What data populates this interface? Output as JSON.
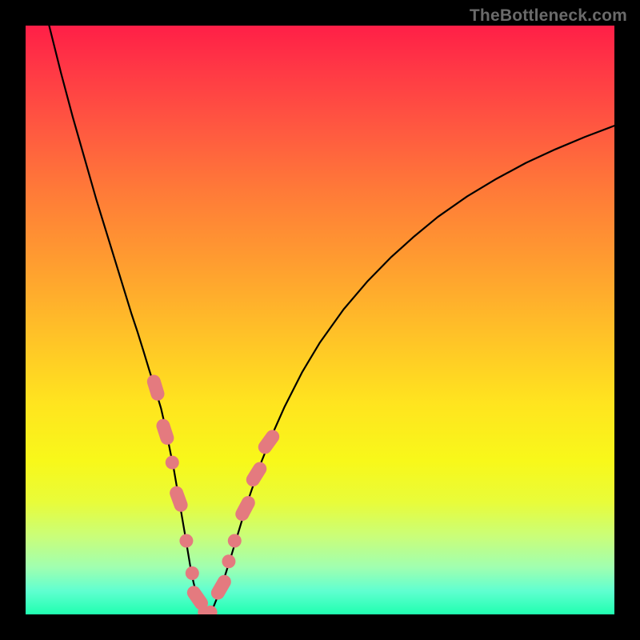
{
  "watermark": "TheBottleneck.com",
  "chart_data": {
    "type": "line",
    "title": "",
    "xlabel": "",
    "ylabel": "",
    "xlim": [
      0,
      100
    ],
    "ylim": [
      0,
      100
    ],
    "grid": false,
    "legend": false,
    "series": [
      {
        "name": "curve",
        "x": [
          4,
          6,
          8,
          10,
          12,
          14,
          16,
          18,
          19,
          20,
          21,
          22,
          23,
          23.8,
          24.5,
          25.2,
          25.8,
          26.4,
          27,
          27.5,
          28,
          28.5,
          29,
          29.5,
          30,
          30.5,
          31,
          31.5,
          32,
          33,
          34,
          35,
          36,
          37,
          38,
          40,
          42,
          44,
          47,
          50,
          54,
          58,
          62,
          66,
          70,
          75,
          80,
          85,
          90,
          95,
          100
        ],
        "y": [
          100,
          92,
          84.5,
          77.5,
          70.5,
          64,
          57.5,
          51,
          48,
          44.8,
          41.5,
          38.3,
          35,
          31.5,
          28,
          24.5,
          21,
          17.5,
          14,
          11,
          8,
          5.5,
          3.5,
          2,
          1,
          0.4,
          0.2,
          0.6,
          1.5,
          4,
          7,
          10.2,
          13.5,
          16.8,
          20,
          25.8,
          30.8,
          35.3,
          41.2,
          46.2,
          51.8,
          56.5,
          60.6,
          64.2,
          67.5,
          71,
          74,
          76.7,
          79,
          81.1,
          83
        ]
      }
    ],
    "markers_left": [
      {
        "x": 22.1,
        "y": 38.5,
        "shape": "pill",
        "angle": 73
      },
      {
        "x": 23.7,
        "y": 31.0,
        "shape": "pill",
        "angle": 72
      },
      {
        "x": 24.9,
        "y": 25.8,
        "shape": "dot"
      },
      {
        "x": 26.0,
        "y": 19.6,
        "shape": "pill",
        "angle": 70
      },
      {
        "x": 27.3,
        "y": 12.5,
        "shape": "dot"
      },
      {
        "x": 28.3,
        "y": 7.0,
        "shape": "dot"
      },
      {
        "x": 29.2,
        "y": 2.8,
        "shape": "pill",
        "angle": 55
      }
    ],
    "markers_bottom": [
      {
        "x": 30.4,
        "y": 0.35,
        "shape": "dot"
      },
      {
        "x": 31.4,
        "y": 0.35,
        "shape": "dot"
      }
    ],
    "markers_right": [
      {
        "x": 33.2,
        "y": 4.6,
        "shape": "pill",
        "angle": -60
      },
      {
        "x": 34.5,
        "y": 9.0,
        "shape": "dot"
      },
      {
        "x": 35.5,
        "y": 12.5,
        "shape": "dot"
      },
      {
        "x": 37.3,
        "y": 18.0,
        "shape": "pill",
        "angle": -62
      },
      {
        "x": 39.2,
        "y": 23.8,
        "shape": "pill",
        "angle": -58
      },
      {
        "x": 41.3,
        "y": 29.3,
        "shape": "pill",
        "angle": -54
      }
    ]
  }
}
